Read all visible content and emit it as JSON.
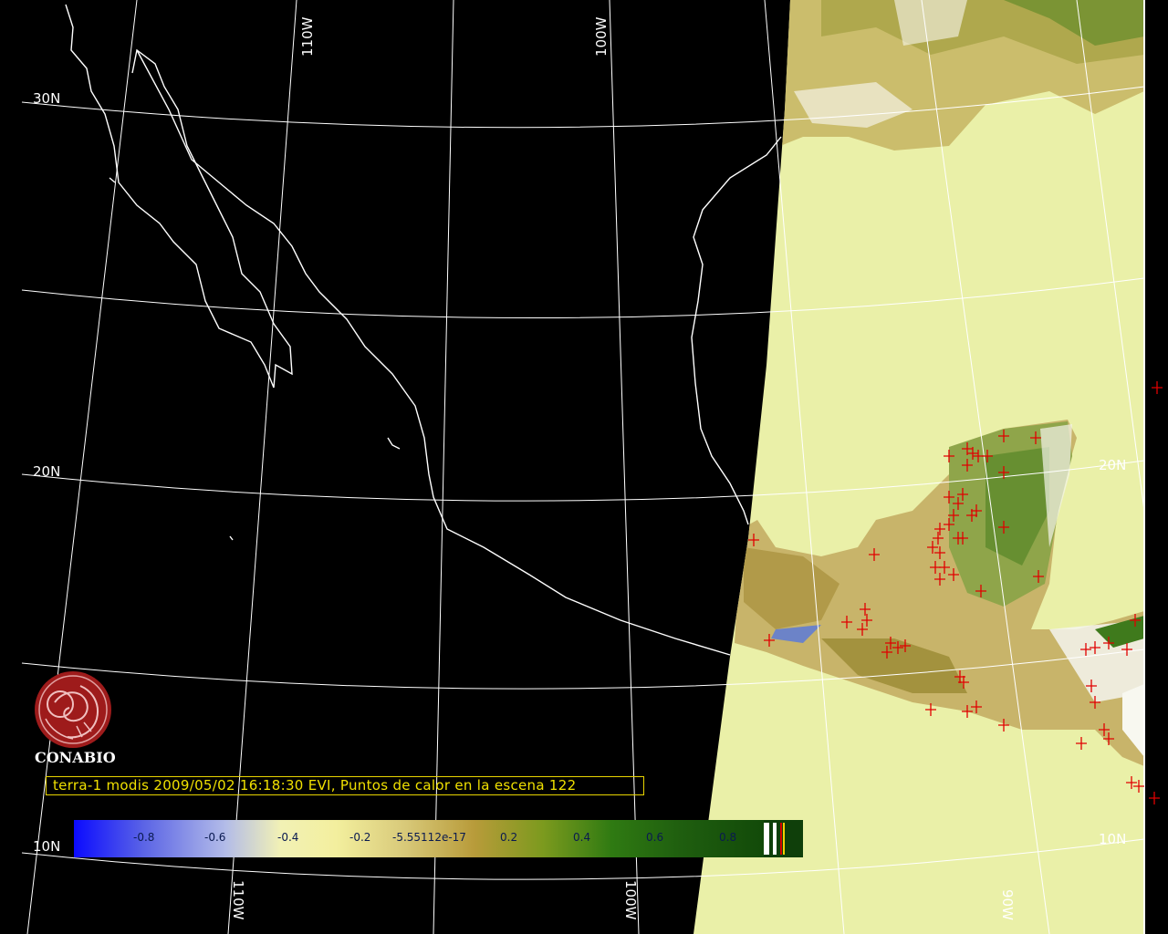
{
  "map": {
    "graticule_labels": {
      "lat_30": "30N",
      "lat_20_left": "20N",
      "lat_20_right": "20N",
      "lat_10_left": "10N",
      "lat_10_right": "10N",
      "lon_110_top": "110W",
      "lon_100_top": "100W",
      "lon_110_bottom": "110W",
      "lon_100_bottom": "100W",
      "lon_90_bottom": "90W"
    },
    "colors": {
      "background": "#000000",
      "land_swath": "#eaf0a8",
      "coastline": "#ffffff",
      "fire_marker": "#e00000",
      "title_text": "#f0e000"
    },
    "fire_marker_symbol": "+"
  },
  "logo": {
    "name": "CONABIO",
    "emblem": "conabio-emblem-icon"
  },
  "title": {
    "text": "terra-1 modis 2009/05/02 16:18:30 EVI, Puntos de calor en la escena 122"
  },
  "colorbar": {
    "ticks": [
      "-0.8",
      "-0.6",
      "-0.4",
      "-0.2",
      "-5.55112e-17",
      "0.2",
      "0.4",
      "0.6",
      "0.8"
    ]
  }
}
